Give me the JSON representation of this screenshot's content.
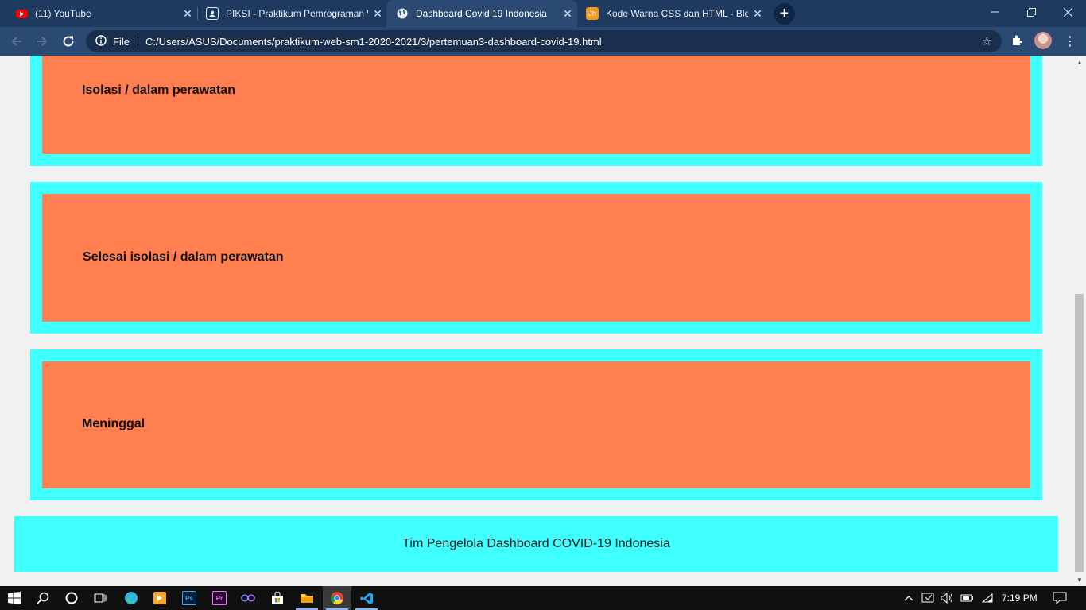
{
  "browser": {
    "tabs": [
      {
        "title": "(11) YouTube",
        "icon": "youtube-icon",
        "active": false
      },
      {
        "title": "PIKSI - Praktikum Pemrograman W",
        "icon": "classroom-icon",
        "active": false
      },
      {
        "title": "Dashboard Covid 19 Indonesia",
        "icon": "globe-icon",
        "active": true
      },
      {
        "title": "Kode Warna CSS dan HTML - Blo",
        "icon": "blogger-icon",
        "active": false
      }
    ],
    "close_glyph": "✕",
    "new_tab_glyph": "+",
    "address": {
      "scheme_label": "File",
      "url": "C:/Users/ASUS/Documents/praktikum-web-sm1-2020-2021/3/pertemuan3-dashboard-covid-19.html"
    }
  },
  "page": {
    "cards": [
      {
        "title": "Isolasi / dalam perawatan"
      },
      {
        "title": "Selesai isolasi / dalam perawatan"
      },
      {
        "title": "Meninggal"
      }
    ],
    "footer": "Tim Pengelola Dashboard COVID-19 Indonesia",
    "colors": {
      "card_outer": "#40ffff",
      "card_inner": "#ff7f50",
      "footer": "#40ffff"
    }
  },
  "taskbar": {
    "clock": "7:19 PM",
    "apps": [
      "start-icon",
      "search-icon",
      "cortana-icon",
      "task-view-icon",
      "edge-icon",
      "media-player-icon",
      "photoshop-icon",
      "premiere-icon",
      "link-icon",
      "store-icon",
      "file-explorer-icon",
      "chrome-icon",
      "vscode-icon"
    ],
    "labels": {
      "photoshop": "Ps",
      "premiere": "Pr"
    }
  }
}
